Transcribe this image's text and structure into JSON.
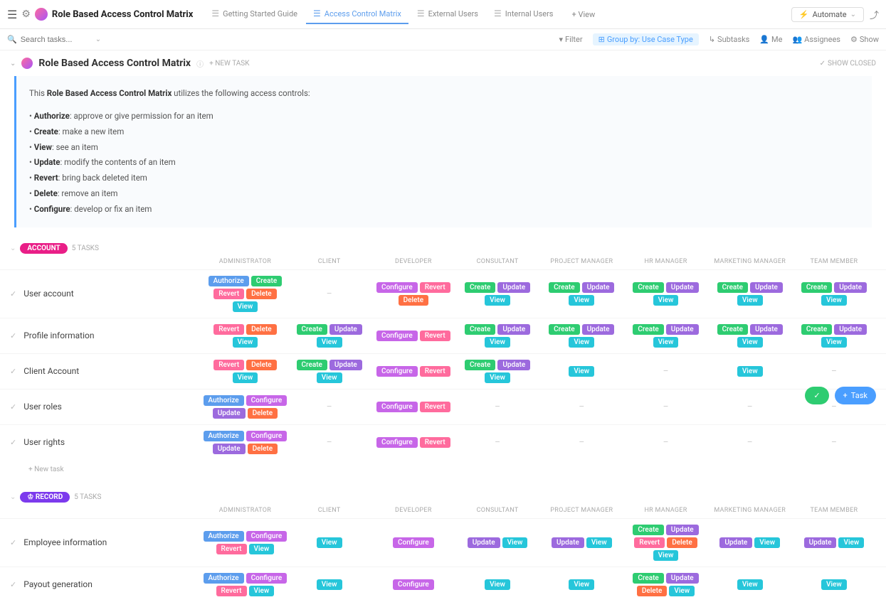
{
  "header": {
    "title": "Role Based Access Control Matrix",
    "tabs": [
      {
        "label": "Getting Started Guide",
        "active": false
      },
      {
        "label": "Access Control Matrix",
        "active": true
      },
      {
        "label": "External Users",
        "active": false
      },
      {
        "label": "Internal Users",
        "active": false
      }
    ],
    "addview": "+ View",
    "automate": "Automate"
  },
  "toolbar": {
    "search_placeholder": "Search tasks...",
    "filter": "Filter",
    "groupby": "Group by: Use Case Type",
    "subtasks": "Subtasks",
    "me": "Me",
    "assignees": "Assignees",
    "show": "Show"
  },
  "section": {
    "title": "Role Based Access Control Matrix",
    "newtask": "+ NEW TASK",
    "showclosed": "SHOW CLOSED"
  },
  "description": {
    "intro_prefix": "This ",
    "intro_bold": "Role Based Access Control Matrix",
    "intro_suffix": " utilizes the following access controls:",
    "items": [
      {
        "term": "Authorize",
        "def": "approve or give permission for an item"
      },
      {
        "term": "Create",
        "def": "make a new item"
      },
      {
        "term": "View",
        "def": "see an item"
      },
      {
        "term": "Update",
        "def": "modify the contents of an item"
      },
      {
        "term": "Revert",
        "def": "bring back deleted item"
      },
      {
        "term": "Delete",
        "def": "remove an item"
      },
      {
        "term": "Configure",
        "def": "develop or fix an item"
      }
    ]
  },
  "roles": [
    "ADMINISTRATOR",
    "CLIENT",
    "DEVELOPER",
    "CONSULTANT",
    "PROJECT MANAGER",
    "HR MANAGER",
    "MARKETING MANAGER",
    "TEAM MEMBER"
  ],
  "groups": [
    {
      "name": "ACCOUNT",
      "badge_class": "badge-account",
      "count": "5 TASKS",
      "tasks": [
        {
          "name": "User account",
          "perms": [
            [
              "Authorize",
              "Create",
              "Revert",
              "Delete",
              "View"
            ],
            [],
            [
              "Configure",
              "Revert",
              "Delete"
            ],
            [
              "Create",
              "Update",
              "View"
            ],
            [
              "Create",
              "Update",
              "View"
            ],
            [
              "Create",
              "Update",
              "View"
            ],
            [
              "Create",
              "Update",
              "View"
            ],
            [
              "Create",
              "Update",
              "View"
            ]
          ]
        },
        {
          "name": "Profile information",
          "perms": [
            [
              "Revert",
              "Delete",
              "View"
            ],
            [
              "Create",
              "Update",
              "View"
            ],
            [
              "Configure",
              "Revert"
            ],
            [
              "Create",
              "Update",
              "View"
            ],
            [
              "Create",
              "Update",
              "View"
            ],
            [
              "Create",
              "Update",
              "View"
            ],
            [
              "Create",
              "Update",
              "View"
            ],
            [
              "Create",
              "Update",
              "View"
            ]
          ]
        },
        {
          "name": "Client Account",
          "perms": [
            [
              "Revert",
              "Delete",
              "View"
            ],
            [
              "Create",
              "Update",
              "View"
            ],
            [
              "Configure",
              "Revert"
            ],
            [
              "Create",
              "Update",
              "View"
            ],
            [
              "View"
            ],
            [],
            [
              "View"
            ],
            []
          ]
        },
        {
          "name": "User roles",
          "perms": [
            [
              "Authorize",
              "Configure",
              "Update",
              "Delete"
            ],
            [],
            [
              "Configure",
              "Revert"
            ],
            [],
            [],
            [],
            [],
            []
          ]
        },
        {
          "name": "User rights",
          "perms": [
            [
              "Authorize",
              "Configure",
              "Update",
              "Delete"
            ],
            [],
            [
              "Configure",
              "Revert"
            ],
            [],
            [],
            [],
            [],
            []
          ]
        }
      ],
      "newtask": "+ New task"
    },
    {
      "name": "RECORD",
      "badge_class": "badge-record",
      "count": "5 TASKS",
      "tasks": [
        {
          "name": "Employee information",
          "perms": [
            [
              "Authorize",
              "Configure",
              "Revert",
              "View"
            ],
            [
              "View"
            ],
            [
              "Configure"
            ],
            [
              "Update",
              "View"
            ],
            [
              "Update",
              "View"
            ],
            [
              "Create",
              "Update",
              "Revert",
              "Delete",
              "View"
            ],
            [
              "Update",
              "View"
            ],
            [
              "Update",
              "View"
            ]
          ]
        },
        {
          "name": "Payout generation",
          "perms": [
            [
              "Authorize",
              "Configure",
              "Revert",
              "View"
            ],
            [
              "View"
            ],
            [
              "Configure"
            ],
            [
              "View"
            ],
            [
              "View"
            ],
            [
              "Create",
              "Update",
              "Delete",
              "View"
            ],
            [
              "View"
            ],
            [
              "View"
            ]
          ]
        }
      ]
    }
  ],
  "perm_class": {
    "Authorize": "p-authorize",
    "Create": "p-create",
    "Revert": "p-revert",
    "Delete": "p-delete",
    "View": "p-view",
    "Update": "p-update",
    "Configure": "p-configure"
  },
  "fab": {
    "task": "Task"
  }
}
